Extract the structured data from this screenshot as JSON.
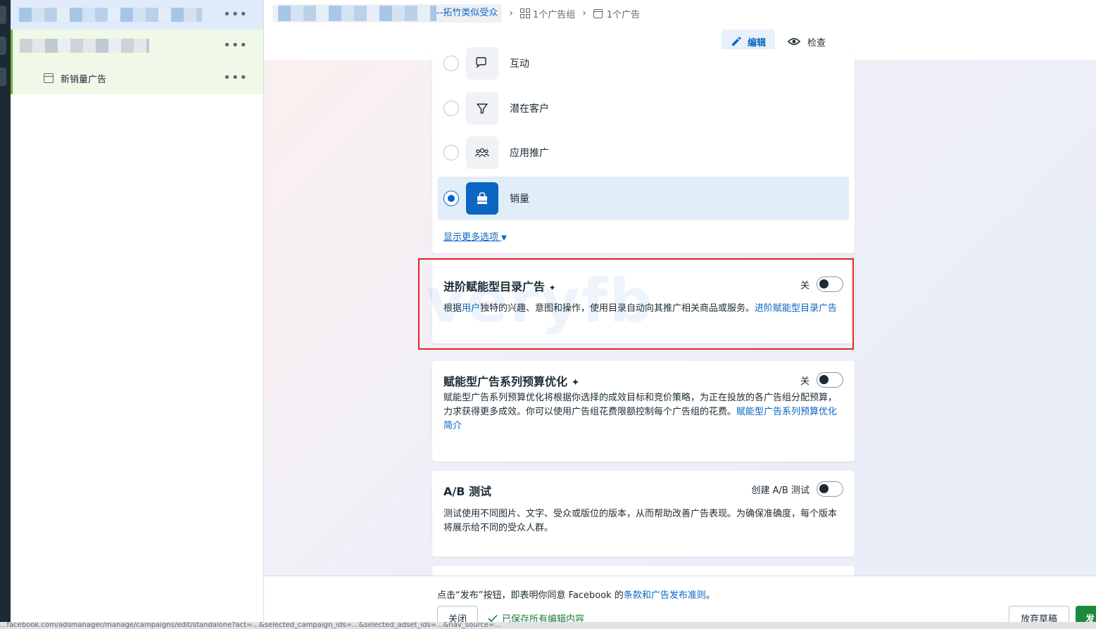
{
  "tree": {
    "items": [
      {
        "label": ""
      },
      {
        "label": ""
      },
      {
        "label": "新销量广告"
      }
    ],
    "more_label": "•••"
  },
  "breadcrumb": {
    "audience": "--拓竹类似受众",
    "adsets": "1个广告组",
    "ads": "1个广告",
    "separator": "›"
  },
  "toolbar": {
    "edit_label": "编辑",
    "review_label": "检查"
  },
  "objective": {
    "options": [
      {
        "label": "互动",
        "icon": "chat-icon",
        "selected": false
      },
      {
        "label": "潜在客户",
        "icon": "funnel-icon",
        "selected": false
      },
      {
        "label": "应用推广",
        "icon": "people-icon",
        "selected": false
      },
      {
        "label": "销量",
        "icon": "shopping-bag-icon",
        "selected": true
      }
    ],
    "more_options": "显示更多选项"
  },
  "catalog": {
    "title": "进阶赋能型目录广告",
    "toggle_label": "关",
    "desc_pre": "根据",
    "desc_user": "用户",
    "desc_mid": "独特的兴趣、意图和操作，使用目录自动向其推广相关商品或服务。",
    "desc_link": "进阶赋能型目录广告"
  },
  "cbo": {
    "title": "赋能型广告系列预算优化",
    "toggle_label": "关",
    "desc": "赋能型广告系列预算优化将根据你选择的成效目标和竞价策略，为正在投放的各广告组分配预算，力求获得更多成效。你可以使用广告组花费限额控制每个广告组的花费。",
    "desc_link": "赋能型广告系列预算优化简介"
  },
  "ab_test": {
    "title": "A/B 测试",
    "toggle_label": "创建 A/B 测试",
    "desc": "测试使用不同图片、文字、受众或版位的版本，从而帮助改善广告表现。为确保准确度，每个版本将展示给不同的受众人群。"
  },
  "footer": {
    "notice_pre": "点击“发布”按钮，即表明你同意 Facebook 的",
    "notice_link": "条款和广告发布准则",
    "notice_post": "。",
    "close_label": "关闭",
    "saved_label": "已保存所有编辑内容",
    "discard_label": "放弃草稿",
    "publish_label": "发"
  },
  "watermark": "veryfb",
  "status_url": "...facebook.com/adsmanager/manage/campaigns/edit/standalone?act=...&selected_campaign_ids=...&selected_adset_ids=...&nav_source=...",
  "colors": {
    "accent": "#0a66c2",
    "highlight_border": "#e02424",
    "success": "#1c7b34",
    "publish": "#1b8a3a"
  }
}
